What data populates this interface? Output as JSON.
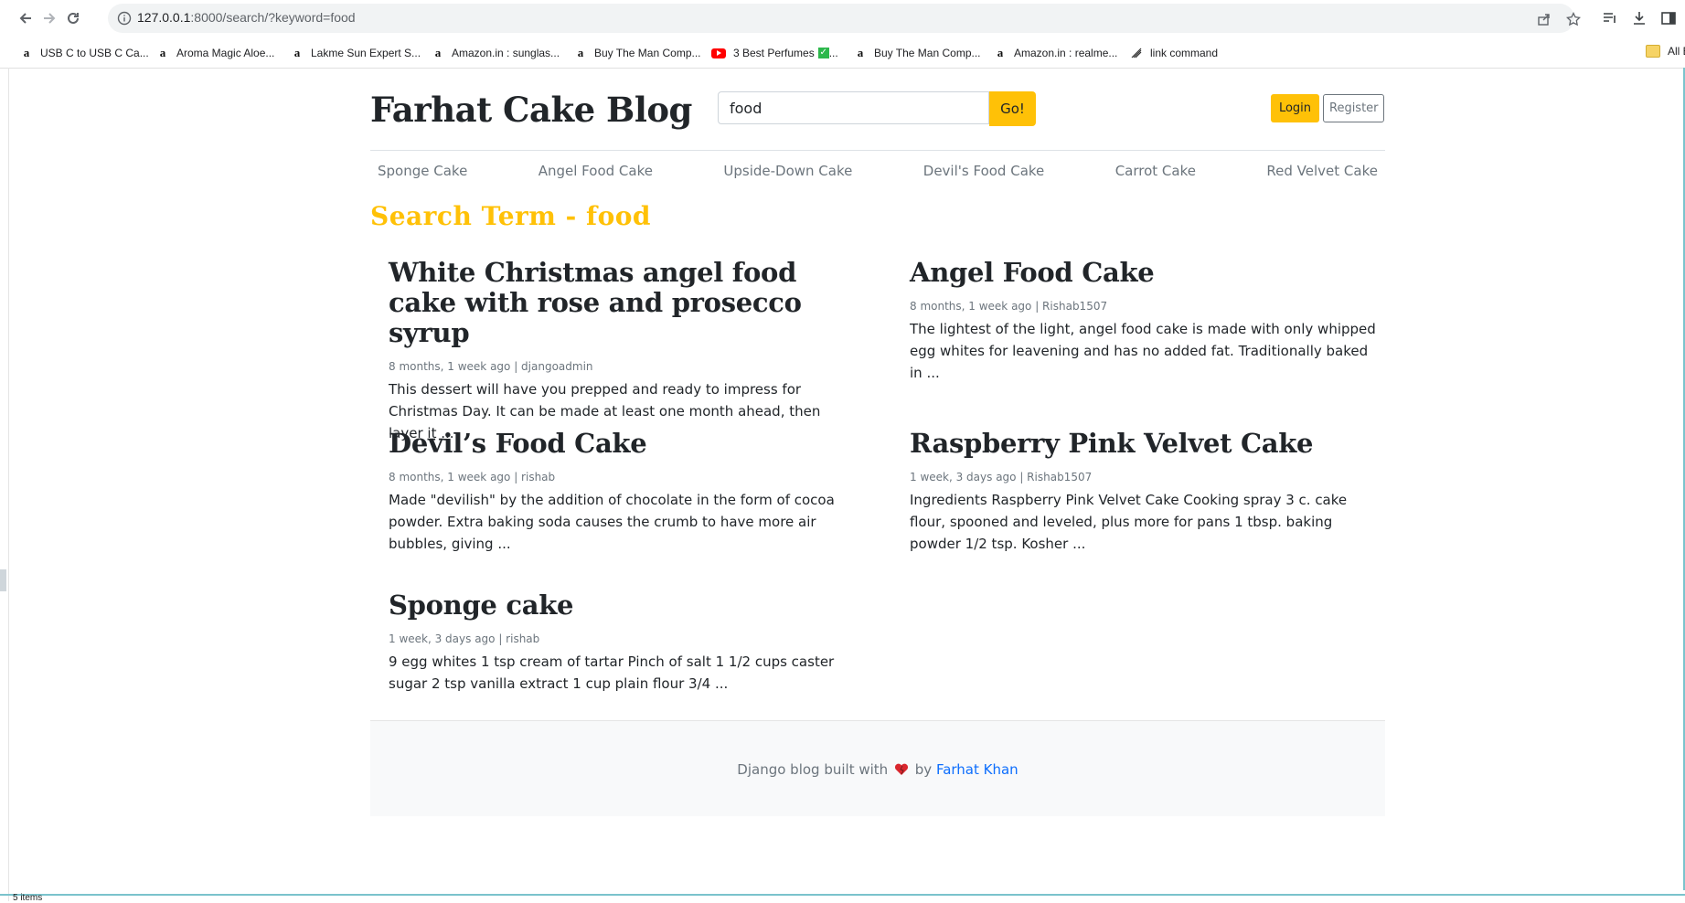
{
  "browser": {
    "url_host": "127.0.0.1",
    "url_rest": ":8000/search/?keyword=food",
    "bookmarks": [
      {
        "label": "USB C to USB C Ca...",
        "icon": "amazon-icon"
      },
      {
        "label": "Aroma Magic Aloe...",
        "icon": "amazon-icon"
      },
      {
        "label": "Lakme Sun Expert S...",
        "icon": "amazon-icon"
      },
      {
        "label": "Amazon.in : sunglas...",
        "icon": "amazon-icon"
      },
      {
        "label": "Buy The Man Comp...",
        "icon": "amazon-icon"
      },
      {
        "label": "3 Best Perfumes",
        "icon": "youtube-icon",
        "suffix": "..."
      },
      {
        "label": "Buy The Man Comp...",
        "icon": "amazon-icon"
      },
      {
        "label": "Amazon.in : realme...",
        "icon": "amazon-icon"
      },
      {
        "label": "link command",
        "icon": "link-icon"
      }
    ],
    "all_bookmarks_label": "All B",
    "status_text": "5 items"
  },
  "site": {
    "title": "Farhat Cake Blog",
    "search_value": "food",
    "search_button": "Go!",
    "login_label": "Login",
    "register_label": "Register",
    "accent_color": "#ffc107"
  },
  "categories": [
    "Sponge Cake",
    "Angel Food Cake",
    "Upside-Down Cake",
    "Devil's Food Cake",
    "Carrot Cake",
    "Red Velvet Cake"
  ],
  "search_heading": "Search Term - food",
  "posts": [
    {
      "title": "White Christmas angel food cake with rose and prosecco syrup",
      "meta": "8 months, 1 week ago | djangoadmin",
      "excerpt": "This dessert will have you prepped and ready to impress for Christmas Day. It can be made at least one month ahead, then layer it ..."
    },
    {
      "title": "Angel Food Cake",
      "meta": "8 months, 1 week ago | Rishab1507",
      "excerpt": "The lightest of the light, angel food cake is made with only whipped egg whites for leavening and has no added fat. Traditionally baked in ..."
    },
    {
      "title": "Devil’s Food Cake",
      "meta": "8 months, 1 week ago | rishab",
      "excerpt": "Made \"devilish\" by the addition of chocolate in the form of cocoa powder. Extra baking soda causes the crumb to have more air bubbles, giving ..."
    },
    {
      "title": "Raspberry Pink Velvet Cake",
      "meta": "1 week, 3 days ago | Rishab1507",
      "excerpt": "Ingredients Raspberry Pink Velvet Cake Cooking spray 3 c. cake flour, spooned and leveled, plus more for pans 1 tbsp. baking powder 1/2 tsp. Kosher ..."
    },
    {
      "title": "Sponge cake",
      "meta": "1 week, 3 days ago | rishab",
      "excerpt": "9 egg whites 1 tsp cream of tartar Pinch of salt 1 1/2 cups caster sugar 2 tsp vanilla extract 1 cup plain flour 3/4 ..."
    }
  ],
  "footer": {
    "prefix": "Django blog built with",
    "by": "by",
    "author": "Farhat Khan"
  }
}
